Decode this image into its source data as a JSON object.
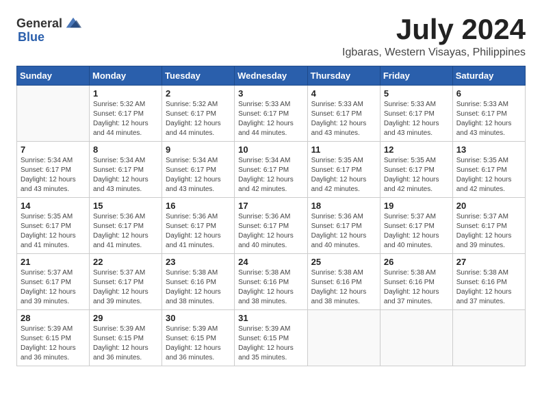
{
  "app": {
    "logo_general": "General",
    "logo_blue": "Blue"
  },
  "calendar": {
    "title": "July 2024",
    "subtitle": "Igbaras, Western Visayas, Philippines",
    "days_of_week": [
      "Sunday",
      "Monday",
      "Tuesday",
      "Wednesday",
      "Thursday",
      "Friday",
      "Saturday"
    ],
    "weeks": [
      [
        {
          "day": "",
          "info": ""
        },
        {
          "day": "1",
          "info": "Sunrise: 5:32 AM\nSunset: 6:17 PM\nDaylight: 12 hours\nand 44 minutes."
        },
        {
          "day": "2",
          "info": "Sunrise: 5:32 AM\nSunset: 6:17 PM\nDaylight: 12 hours\nand 44 minutes."
        },
        {
          "day": "3",
          "info": "Sunrise: 5:33 AM\nSunset: 6:17 PM\nDaylight: 12 hours\nand 44 minutes."
        },
        {
          "day": "4",
          "info": "Sunrise: 5:33 AM\nSunset: 6:17 PM\nDaylight: 12 hours\nand 43 minutes."
        },
        {
          "day": "5",
          "info": "Sunrise: 5:33 AM\nSunset: 6:17 PM\nDaylight: 12 hours\nand 43 minutes."
        },
        {
          "day": "6",
          "info": "Sunrise: 5:33 AM\nSunset: 6:17 PM\nDaylight: 12 hours\nand 43 minutes."
        }
      ],
      [
        {
          "day": "7",
          "info": ""
        },
        {
          "day": "8",
          "info": "Sunrise: 5:34 AM\nSunset: 6:17 PM\nDaylight: 12 hours\nand 43 minutes."
        },
        {
          "day": "9",
          "info": "Sunrise: 5:34 AM\nSunset: 6:17 PM\nDaylight: 12 hours\nand 43 minutes."
        },
        {
          "day": "10",
          "info": "Sunrise: 5:34 AM\nSunset: 6:17 PM\nDaylight: 12 hours\nand 42 minutes."
        },
        {
          "day": "11",
          "info": "Sunrise: 5:35 AM\nSunset: 6:17 PM\nDaylight: 12 hours\nand 42 minutes."
        },
        {
          "day": "12",
          "info": "Sunrise: 5:35 AM\nSunset: 6:17 PM\nDaylight: 12 hours\nand 42 minutes."
        },
        {
          "day": "13",
          "info": "Sunrise: 5:35 AM\nSunset: 6:17 PM\nDaylight: 12 hours\nand 42 minutes."
        }
      ],
      [
        {
          "day": "14",
          "info": ""
        },
        {
          "day": "15",
          "info": "Sunrise: 5:36 AM\nSunset: 6:17 PM\nDaylight: 12 hours\nand 41 minutes."
        },
        {
          "day": "16",
          "info": "Sunrise: 5:36 AM\nSunset: 6:17 PM\nDaylight: 12 hours\nand 41 minutes."
        },
        {
          "day": "17",
          "info": "Sunrise: 5:36 AM\nSunset: 6:17 PM\nDaylight: 12 hours\nand 40 minutes."
        },
        {
          "day": "18",
          "info": "Sunrise: 5:36 AM\nSunset: 6:17 PM\nDaylight: 12 hours\nand 40 minutes."
        },
        {
          "day": "19",
          "info": "Sunrise: 5:37 AM\nSunset: 6:17 PM\nDaylight: 12 hours\nand 40 minutes."
        },
        {
          "day": "20",
          "info": "Sunrise: 5:37 AM\nSunset: 6:17 PM\nDaylight: 12 hours\nand 39 minutes."
        }
      ],
      [
        {
          "day": "21",
          "info": ""
        },
        {
          "day": "22",
          "info": "Sunrise: 5:37 AM\nSunset: 6:17 PM\nDaylight: 12 hours\nand 39 minutes."
        },
        {
          "day": "23",
          "info": "Sunrise: 5:38 AM\nSunset: 6:16 PM\nDaylight: 12 hours\nand 38 minutes."
        },
        {
          "day": "24",
          "info": "Sunrise: 5:38 AM\nSunset: 6:16 PM\nDaylight: 12 hours\nand 38 minutes."
        },
        {
          "day": "25",
          "info": "Sunrise: 5:38 AM\nSunset: 6:16 PM\nDaylight: 12 hours\nand 38 minutes."
        },
        {
          "day": "26",
          "info": "Sunrise: 5:38 AM\nSunset: 6:16 PM\nDaylight: 12 hours\nand 37 minutes."
        },
        {
          "day": "27",
          "info": "Sunrise: 5:38 AM\nSunset: 6:16 PM\nDaylight: 12 hours\nand 37 minutes."
        }
      ],
      [
        {
          "day": "28",
          "info": "Sunrise: 5:39 AM\nSunset: 6:15 PM\nDaylight: 12 hours\nand 36 minutes."
        },
        {
          "day": "29",
          "info": "Sunrise: 5:39 AM\nSunset: 6:15 PM\nDaylight: 12 hours\nand 36 minutes."
        },
        {
          "day": "30",
          "info": "Sunrise: 5:39 AM\nSunset: 6:15 PM\nDaylight: 12 hours\nand 36 minutes."
        },
        {
          "day": "31",
          "info": "Sunrise: 5:39 AM\nSunset: 6:15 PM\nDaylight: 12 hours\nand 35 minutes."
        },
        {
          "day": "",
          "info": ""
        },
        {
          "day": "",
          "info": ""
        },
        {
          "day": "",
          "info": ""
        }
      ]
    ],
    "week_7_sun": "Sunrise: 5:34 AM\nSunset: 6:17 PM\nDaylight: 12 hours\nand 43 minutes.",
    "week_14_sun": "Sunrise: 5:35 AM\nSunset: 6:17 PM\nDaylight: 12 hours\nand 41 minutes.",
    "week_21_sun": "Sunrise: 5:37 AM\nSunset: 6:17 PM\nDaylight: 12 hours\nand 39 minutes."
  }
}
